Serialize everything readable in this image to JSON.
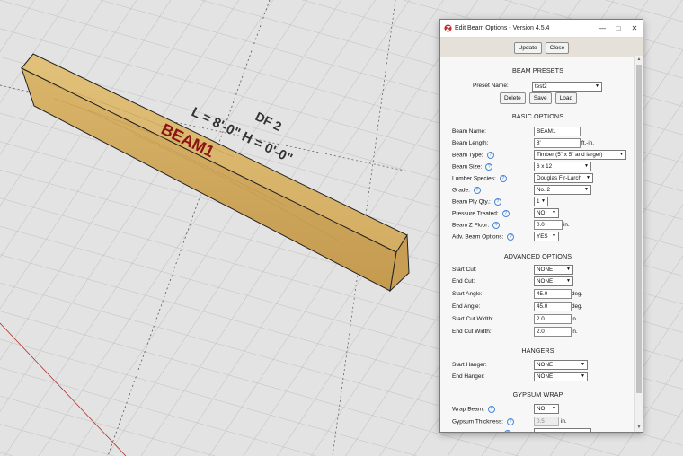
{
  "window": {
    "title": "Edit Beam Options - Version 4.5.4",
    "update_label": "Update",
    "close_label": "Close"
  },
  "model": {
    "label_line1": "DF 2",
    "label_line2": "L = 8'-0\" H = 0'-0\"",
    "beam_name": "BEAM1"
  },
  "presets": {
    "title": "BEAM PRESETS",
    "preset_name_label": "Preset Name:",
    "preset_name_value": "test2",
    "delete_label": "Delete",
    "save_label": "Save",
    "load_label": "Load"
  },
  "basic": {
    "title": "BASIC OPTIONS",
    "beam_name_label": "Beam Name:",
    "beam_name_value": "BEAM1",
    "beam_length_label": "Beam Length:",
    "beam_length_value": "8'",
    "beam_length_unit": "ft.-in.",
    "beam_type_label": "Beam Type:",
    "beam_type_value": "Timber (5\" x 5\" and larger)",
    "beam_size_label": "Beam Size:",
    "beam_size_value": "6 x 12",
    "lumber_species_label": "Lumber Species:",
    "lumber_species_value": "Douglas Fir-Larch",
    "grade_label": "Grade:",
    "grade_value": "No. 2",
    "ply_label": "Beam Ply Qty.:",
    "ply_value": "1",
    "pressure_label": "Pressure Treated:",
    "pressure_value": "NO",
    "zfloor_label": "Beam Z Floor:",
    "zfloor_value": "0.0",
    "zfloor_unit": "in.",
    "adv_label": "Adv. Beam Options:",
    "adv_value": "YES"
  },
  "advanced": {
    "title": "ADVANCED OPTIONS",
    "start_cut_label": "Start Cut:",
    "start_cut_value": "NONE",
    "end_cut_label": "End Cut:",
    "end_cut_value": "NONE",
    "start_angle_label": "Start Angle:",
    "start_angle_value": "45.0",
    "end_angle_label": "End Angle:",
    "end_angle_value": "45.0",
    "deg_unit": "deg.",
    "start_cut_width_label": "Start Cut Width:",
    "start_cut_width_value": "2.0",
    "end_cut_width_label": "End Cut Width:",
    "end_cut_width_value": "2.0",
    "in_unit": "in."
  },
  "hangers": {
    "title": "HANGERS",
    "start_hanger_label": "Start Hanger:",
    "start_hanger_value": "NONE",
    "end_hanger_label": "End Hanger:",
    "end_hanger_value": "NONE"
  },
  "gypsum": {
    "title": "GYPSUM WRAP",
    "wrap_label": "Wrap Beam:",
    "wrap_value": "NO",
    "thickness_label": "Gypsum Thickness:",
    "thickness_value": "0.5",
    "thickness_unit": "in."
  },
  "colors": {
    "grid_bg": "#e3e3e3",
    "beam_name_red": "#8a1414",
    "help_blue": "#4a86d8"
  }
}
